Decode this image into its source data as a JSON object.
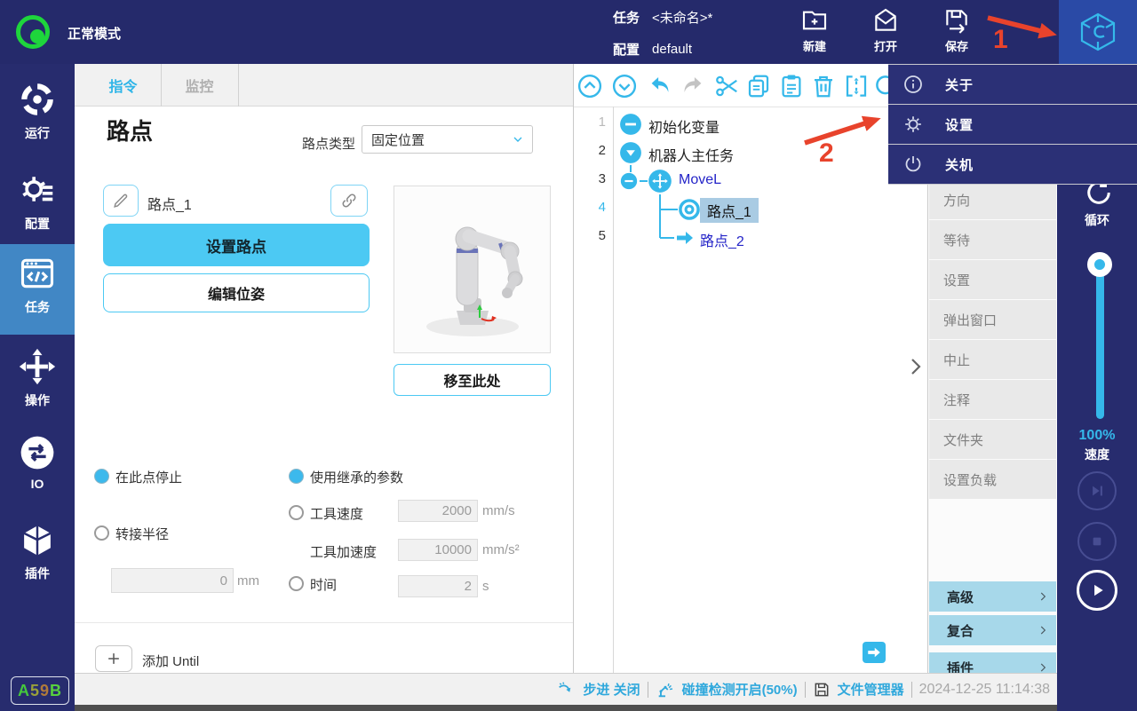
{
  "topbar": {
    "mode": "正常模式",
    "task_label": "任务",
    "task_value": "<未命名>*",
    "config_label": "配置",
    "config_value": "default",
    "new_label": "新建",
    "open_label": "打开",
    "save_label": "保存"
  },
  "menu": {
    "about": "关于",
    "settings": "设置",
    "shutdown": "关机"
  },
  "annotations": {
    "step1": "1",
    "step2": "2"
  },
  "sidebar": {
    "run": "运行",
    "config": "配置",
    "task": "任务",
    "jog": "操作",
    "io": "IO",
    "plugin": "插件",
    "badge": [
      {
        "ch": "A",
        "color": "#45c83c"
      },
      {
        "ch": "5",
        "color": "#9aa03a"
      },
      {
        "ch": "9",
        "color": "#b07a3a"
      },
      {
        "ch": "B",
        "color": "#58d13e"
      }
    ]
  },
  "tabs": {
    "command": "指令",
    "monitor": "监控"
  },
  "waypoint": {
    "title": "路点",
    "type_label": "路点类型",
    "type_value": "固定位置",
    "name": "路点_1",
    "set_btn": "设置路点",
    "edit_btn": "编辑位姿",
    "move_btn": "移至此处",
    "stop_opt": "在此点停止",
    "radius_opt": "转接半径",
    "radius_value": "0",
    "radius_unit": "mm",
    "inherit_opt": "使用继承的参数",
    "speed_opt": "工具速度",
    "speed_value": "2000",
    "speed_unit": "mm/s",
    "accel_label": "工具加速度",
    "accel_value": "10000",
    "accel_unit": "mm/s²",
    "time_opt": "时间",
    "time_value": "2",
    "time_unit": "s",
    "add_until": "添加 Until"
  },
  "tree": {
    "rows": [
      {
        "num": "1",
        "label": "初始化变量"
      },
      {
        "num": "2",
        "label": "机器人主任务"
      },
      {
        "num": "3",
        "label": "MoveL"
      },
      {
        "num": "4",
        "label": "路点_1"
      },
      {
        "num": "5",
        "label": "路点_2"
      }
    ]
  },
  "commands": {
    "items": [
      "方向",
      "等待",
      "设置",
      "弹出窗口",
      "中止",
      "注释",
      "文件夹",
      "设置负载"
    ],
    "advanced": "高级",
    "composite": "复合",
    "plugin": "插件"
  },
  "rail": {
    "loop": "循环",
    "pct": "100%",
    "speed": "速度"
  },
  "status": {
    "step": "步进 关闭",
    "collision": "碰撞检测开启(50%)",
    "files": "文件管理器",
    "datetime": "2024-12-25 11:14:38"
  },
  "colors": {
    "accent": "#35b8ea",
    "topbar": "#252a6b",
    "sidebar": "#272c6e",
    "menu_bg": "#2b3076",
    "active_item": "#4187c5",
    "annotation": "#e8432c",
    "status_green": "#1ed53c",
    "selection": "#a9cbe3"
  }
}
